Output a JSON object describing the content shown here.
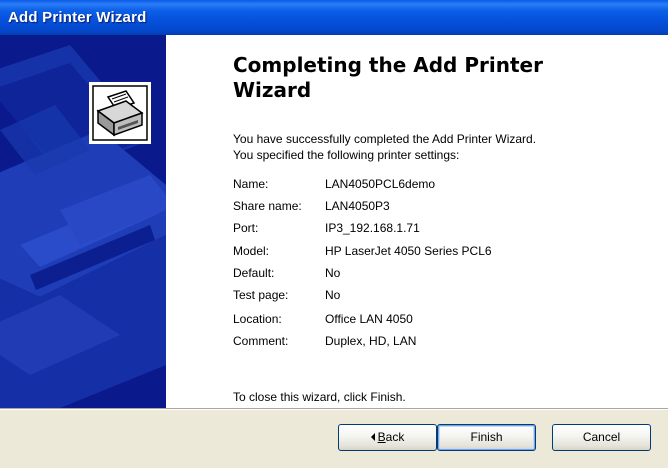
{
  "window": {
    "title": "Add Printer Wizard"
  },
  "content": {
    "heading_line1": "Completing the Add Printer",
    "heading_line2": "Wizard",
    "intro_line1": "You have successfully completed the Add Printer Wizard.",
    "intro_line2": "You specified the following printer settings:",
    "settings": [
      {
        "label": "Name:",
        "value": "LAN4050PCL6demo"
      },
      {
        "label": "Share name:",
        "value": "LAN4050P3"
      },
      {
        "label": "Port:",
        "value": "IP3_192.168.1.71"
      },
      {
        "label": "Model:",
        "value": "HP LaserJet 4050 Series PCL6"
      },
      {
        "label": "Default:",
        "value": "No"
      },
      {
        "label": "Test page:",
        "value": "No"
      },
      {
        "label": "Location:",
        "value": "Office LAN 4050"
      },
      {
        "label": "Comment:",
        "value": "Duplex, HD, LAN"
      }
    ],
    "closing": "To close this wizard, click Finish."
  },
  "buttons": {
    "back_mnemonic": "B",
    "back_rest": "ack",
    "finish": "Finish",
    "cancel": "Cancel"
  },
  "colors": {
    "title_bar": "#0550dc",
    "banner": "#0a1a8c",
    "button_border": "#003c74"
  }
}
